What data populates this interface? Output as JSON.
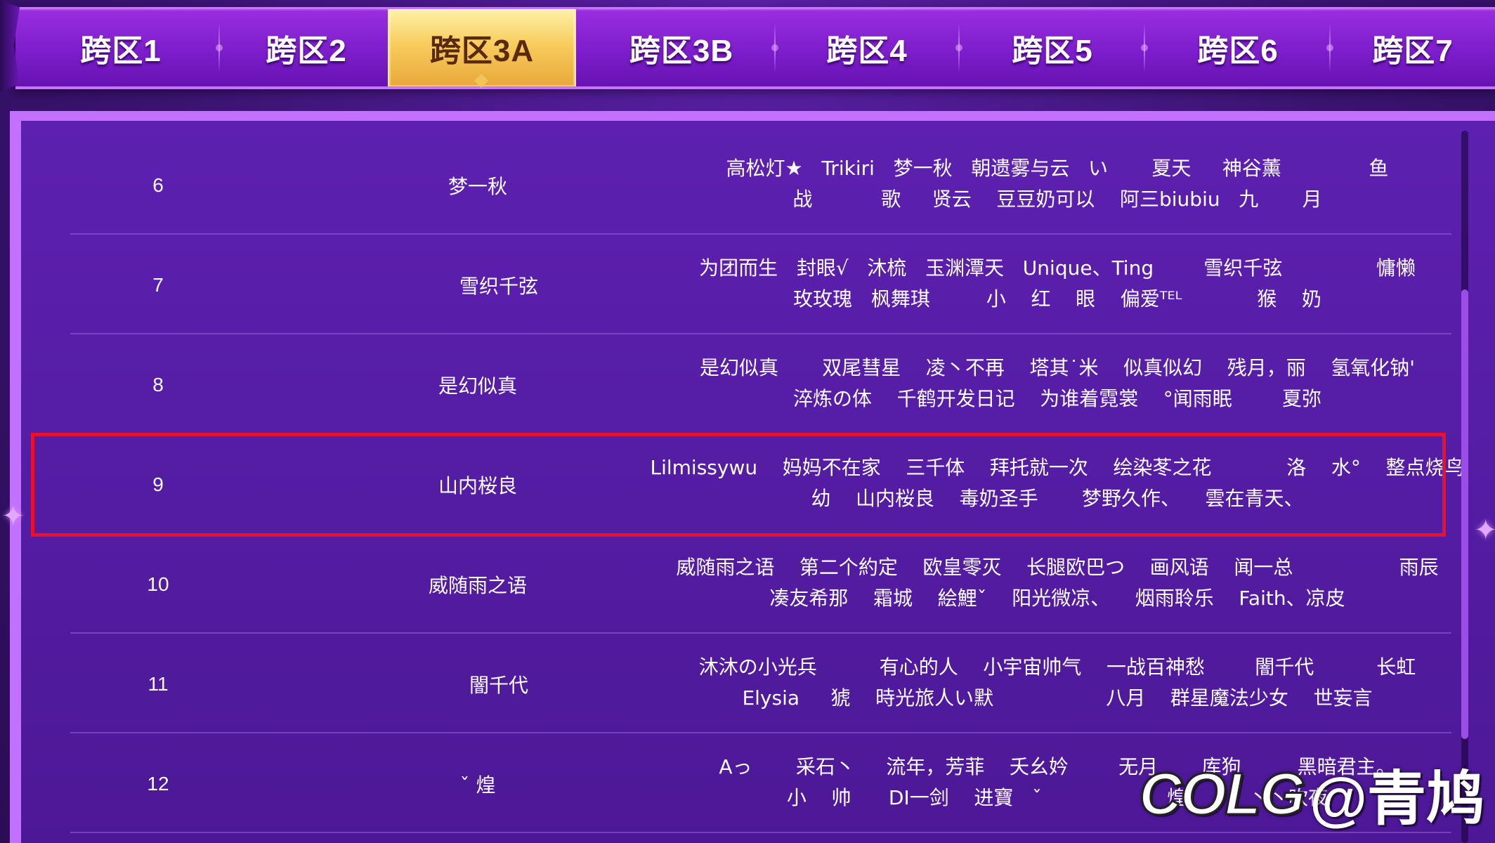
{
  "tabs": [
    {
      "label": "跨区1",
      "active": false
    },
    {
      "label": "跨区2",
      "active": false
    },
    {
      "label": "跨区3A",
      "active": true
    },
    {
      "label": "跨区3B",
      "active": false
    },
    {
      "label": "跨区4",
      "active": false
    },
    {
      "label": "跨区5",
      "active": false
    },
    {
      "label": "跨区6",
      "active": false
    },
    {
      "label": "跨区7",
      "active": false
    }
  ],
  "rows": [
    {
      "rank": "6",
      "leader": "梦一秋",
      "line1": "高松灯★   Trikiri   梦一秋   朝遗雾与云   い       夏天     神谷薰              鱼",
      "line2": "战           歌     贤云    豆豆奶可以    阿三biubiu   九       月"
    },
    {
      "rank": "7",
      "leader": "雪织千弦",
      "line1": "为团而生   封眼√   沐梳   玉渊潭天   Unique、Ting        雪织千弦               慵懒",
      "line2": "玫玫瑰   枫舞琪         小    红    眼    偏爱ᵀᴱᴸ            猴    奶"
    },
    {
      "rank": "8",
      "leader": "是幻似真",
      "line1": "是幻似真       双尾彗星    凌丶不再    塔其˙米    似真似幻    残月，丽    氢氧化钠'",
      "line2": "淬炼の体    千鹤开发日记    为谁着霓裳    °闻雨眠        夏弥"
    },
    {
      "rank": "9",
      "leader": "山内桜良",
      "line1": "Lilmissywu    妈妈不在家    三千体    拜托就一次    绘染苳之花            洛    水°    整点烧鸟",
      "line2": "幼    山内桜良    毒奶圣手       梦野久作、    雲在青天、"
    },
    {
      "rank": "10",
      "leader": "威随雨之语",
      "line1": "威随雨之语    第二个約定    欧皇零灭    长腿欧巴つ    画风语    闻一总                 雨辰",
      "line2": "凑友希那    霜城    絵鯉ˇ    阳光微凉、    烟雨聆乐    Faith、凉皮"
    },
    {
      "rank": "11",
      "leader": "闇千代",
      "line1": "沐沐の小光兵          有心的人    小宇宙帅气    一战百神愁        闇千代          长虹",
      "line2": "Elysia     猇    時光旅人い默                  八月    群星魔法少女    世妄言"
    },
    {
      "rank": "12",
      "leader": "ˇ              煌",
      "line1": "Aっ       采石丶     流年，芳菲    夭幺妗        无月       库狗         黑暗君主。",
      "line2": "小    帅      DI一剑    进寶   ˇ                    煌          丶丶吹夜"
    }
  ],
  "watermark": {
    "logo": "COLG",
    "handle": "@青鸠"
  }
}
